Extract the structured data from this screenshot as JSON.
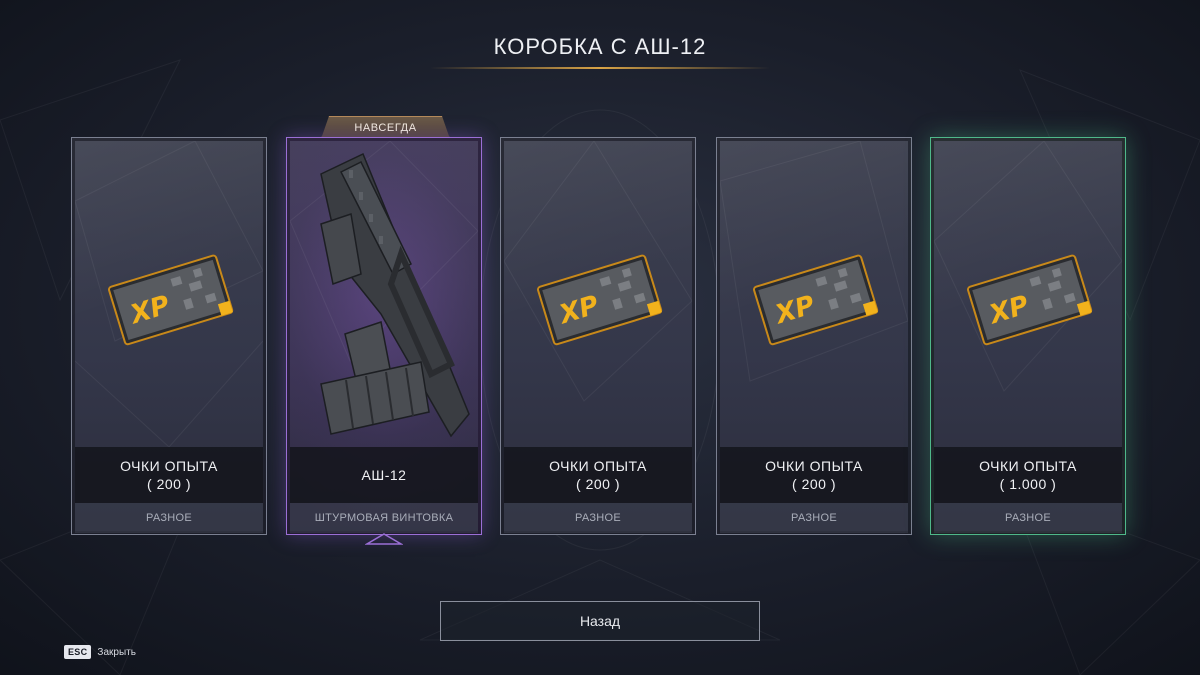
{
  "title": "КОРОБКА С АШ-12",
  "badge": "НАВСЕГДА",
  "cards": [
    {
      "line1": "ОЧКИ ОПЫТА",
      "line2": "( 200 )",
      "category": "РАЗНОЕ",
      "icon": "xp-card-icon",
      "rarity": "common"
    },
    {
      "line1": "АШ-12",
      "line2": "",
      "category": "ШТУРМОВАЯ ВИНТОВКА",
      "icon": "rifle-icon",
      "rarity": "legendary"
    },
    {
      "line1": "ОЧКИ ОПЫТА",
      "line2": "( 200 )",
      "category": "РАЗНОЕ",
      "icon": "xp-card-icon",
      "rarity": "common"
    },
    {
      "line1": "ОЧКИ ОПЫТА",
      "line2": "( 200 )",
      "category": "РАЗНОЕ",
      "icon": "xp-card-icon",
      "rarity": "common"
    },
    {
      "line1": "ОЧКИ ОПЫТА",
      "line2": "( 1.000 )",
      "category": "РАЗНОЕ",
      "icon": "xp-card-icon",
      "rarity": "uncommon"
    }
  ],
  "xp_glyph": "XP",
  "back_button": "Назад",
  "esc_key": "ESC",
  "esc_label": "Закрыть",
  "colors": {
    "accent_gold": "#d9a446",
    "legendary_purple": "#9b6fd6",
    "uncommon_green": "#4fb88a",
    "xp_yellow": "#f2b21c"
  }
}
